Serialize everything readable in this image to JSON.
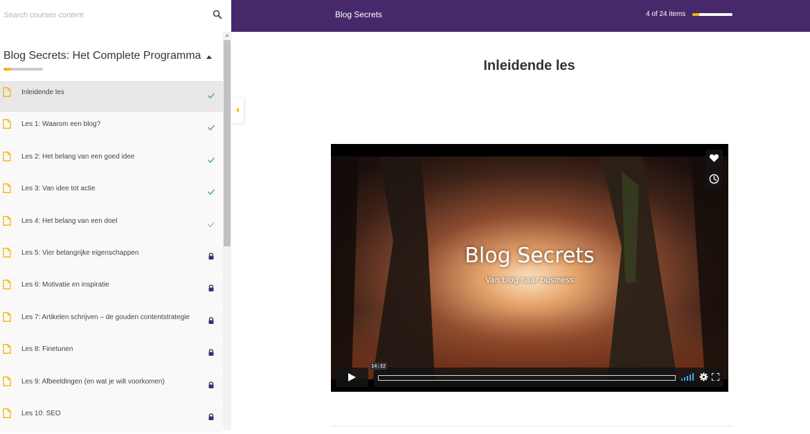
{
  "search": {
    "placeholder": "Search courses content"
  },
  "section": {
    "title": "Blog Secrets: Het Complete Programma",
    "progress": 0.2
  },
  "lessons": [
    {
      "label": "Inleidende les",
      "status": "completed",
      "active": true
    },
    {
      "label": "Les 1: Waarom een blog?",
      "status": "completed"
    },
    {
      "label": "Les 2: Het belang van een goed idee",
      "status": "completed"
    },
    {
      "label": "Les 3: Van idee tot actie",
      "status": "completed"
    },
    {
      "label": "Les 4: Het belang van een doel",
      "status": "viewed"
    },
    {
      "label": "Les 5: Vier belangrijke eigenschappen",
      "status": "locked"
    },
    {
      "label": "Les 6: Motivatie en inspiratie",
      "status": "locked"
    },
    {
      "label": "Les 7: Artikelen schrijven – de gouden contentstrategie",
      "status": "locked"
    },
    {
      "label": "Les 8: Finetunen",
      "status": "locked"
    },
    {
      "label": "Les 9: Afbeeldingen (en wat je wilt voorkomen)",
      "status": "locked"
    },
    {
      "label": "Les 10: SEO",
      "status": "locked"
    }
  ],
  "topbar": {
    "course_name": "Blog Secrets",
    "progress_text": "4 of 24 items",
    "progress": 0.1667
  },
  "lesson_title": "Inleidende les",
  "video": {
    "title": "Blog Secrets",
    "subtitle": "Van blog naar business",
    "timecode": "14:32"
  },
  "colors": {
    "topbar": "#47296b",
    "accent": "#f5b400",
    "check": "#5cb85c",
    "lock": "#47296b"
  },
  "icons": {
    "search": "search-icon",
    "doc": "document-icon",
    "check": "check-icon",
    "lock": "lock-icon",
    "heart": "heart-icon",
    "clock": "clock-icon",
    "play": "play-icon",
    "volume": "volume-icon",
    "gear": "gear-icon",
    "fullscreen": "fullscreen-icon"
  }
}
